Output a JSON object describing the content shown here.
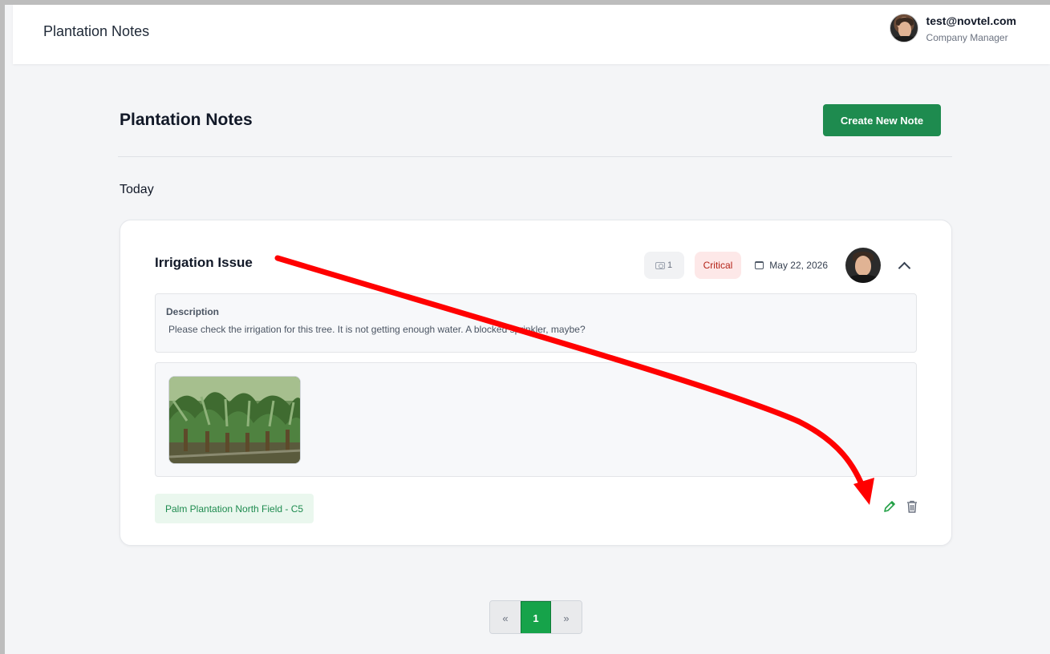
{
  "app": {
    "title": "Plantation Notes"
  },
  "user": {
    "email": "test@novtel.com",
    "role": "Company Manager"
  },
  "page": {
    "title": "Plantation Notes",
    "create_button_label": "Create New Note",
    "section_label": "Today"
  },
  "note": {
    "title": "Irrigation Issue",
    "photo_count": "1",
    "severity": "Critical",
    "date": "May 22, 2026",
    "description_label": "Description",
    "description_text": "Please check the irrigation for this tree. It is not getting enough water. A blocked sprinkler, maybe?",
    "location": "Palm Plantation North Field - C5",
    "icons": [
      "camera-icon",
      "calendar-icon",
      "chevron-up-icon",
      "pencil-icon",
      "trash-icon"
    ]
  },
  "pagination": {
    "prev": "«",
    "current": "1",
    "next": "»"
  },
  "colors": {
    "primary_green": "#1e8b4f",
    "active_page": "#16a34a",
    "critical_bg": "#fde8e8",
    "critical_text": "#b42318",
    "annotation_arrow": "#ff0000"
  }
}
